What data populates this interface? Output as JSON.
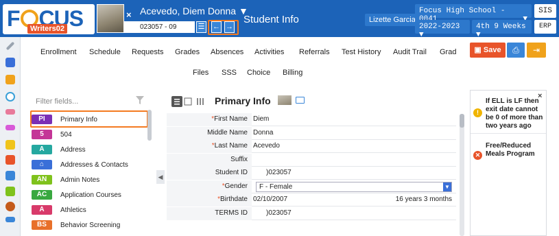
{
  "header": {
    "logo_text": "F   CUS",
    "badge": "Writers02",
    "student_name": "Acevedo, Diem Donna ▼",
    "student_id": "023057 - 09",
    "module_title": "Student Info",
    "user": "Lizette Garcia",
    "school": "Focus High School - 0041",
    "school_caret": "▼",
    "year": "2022-2023 ▼",
    "term": "4th 9 Weeks ▼",
    "sis": "SIS",
    "erp": "ERP",
    "prev_arrow": "←",
    "next_arrow": "→",
    "list_icon": "☰",
    "close_x": "×"
  },
  "tabs": [
    "Enrollment",
    "Schedule",
    "Requests",
    "Grades",
    "Absences",
    "Activities",
    "Referrals",
    "Test History",
    "Audit Trail",
    "Grad",
    "Files",
    "SSS",
    "Choice",
    "Billing"
  ],
  "actions": {
    "save": "Save",
    "print_icon": "printer-icon",
    "exit_icon": "exit-icon"
  },
  "filter_placeholder": "Filter fields...",
  "fields_list": [
    {
      "badge": "PI",
      "label": "Primary Info",
      "color": "#7b2fb5"
    },
    {
      "badge": "5",
      "label": "504",
      "color": "#c43597"
    },
    {
      "badge": "A",
      "label": "Address",
      "color": "#25a8a0"
    },
    {
      "badge": "⌂",
      "label": "Addresses & Contacts",
      "color": "#3a6fd8"
    },
    {
      "badge": "AN",
      "label": "Admin Notes",
      "color": "#7fc21c"
    },
    {
      "badge": "AC",
      "label": "Application Courses",
      "color": "#39a840"
    },
    {
      "badge": "A",
      "label": "Athletics",
      "color": "#d83a6a"
    },
    {
      "badge": "BS",
      "label": "Behavior Screening",
      "color": "#e8702a"
    }
  ],
  "panel_title": "Primary Info",
  "form": [
    {
      "label": "First Name",
      "required": true,
      "value": "Diem"
    },
    {
      "label": "Middle Name",
      "required": false,
      "value": "Donna"
    },
    {
      "label": "Last Name",
      "required": true,
      "value": "Acevedo"
    },
    {
      "label": "Suffix",
      "required": false,
      "value": ""
    },
    {
      "label": "Student ID",
      "required": false,
      "value": ")023057"
    },
    {
      "label": "Gender",
      "required": true,
      "value": "F - Female"
    },
    {
      "label": "Birthdate",
      "required": true,
      "value": "02/10/2007"
    },
    {
      "label": "TERMS ID",
      "required": false,
      "value": ")023057"
    }
  ],
  "age_text": "16 years 3 months",
  "alerts": [
    {
      "text": "If ELL is LF then exit date cannot be 0 of more than two years ago",
      "color": "#f0b400",
      "icon": "!"
    },
    {
      "text": "Free/Reduced Meals Program",
      "color": "#e8542a",
      "icon": "✕"
    }
  ],
  "alerts_close": "×",
  "req_mark": "*",
  "collapse_arrow": "◀"
}
